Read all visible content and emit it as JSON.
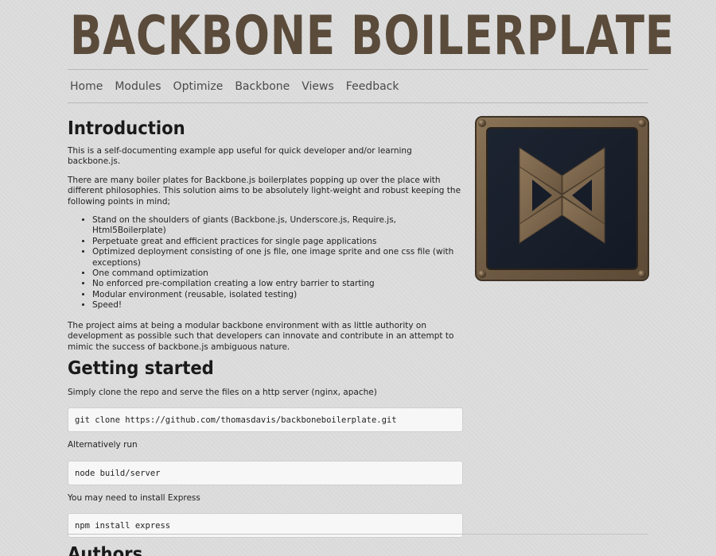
{
  "header": {
    "title": "BACKBONE BOILERPLATE"
  },
  "nav": {
    "items": [
      "Home",
      "Modules",
      "Optimize",
      "Backbone",
      "Views",
      "Feedback"
    ]
  },
  "intro": {
    "heading": "Introduction",
    "p1": "This is a self-documenting example app useful for quick developer and/or learning backbone.js.",
    "p2": "There are many boiler plates for Backbone.js boilerplates popping up over the place with different philosophies. This solution aims to be absolutely light-weight and robust keeping the following points in mind;",
    "points": [
      "Stand on the shoulders of giants (Backbone.js, Underscore.js, Require.js, Html5Boilerplate)",
      "Perpetuate great and efficient practices for single page applications",
      "Optimized deployment consisting of one js file, one image sprite and one css file (with exceptions)",
      "One command optimization",
      "No enforced pre-compilation creating a low entry barrier to starting",
      "Modular environment (reusable, isolated testing)",
      "Speed!"
    ],
    "p3": "The project aims at being a modular backbone environment with as little authority on development as possible such that developers can innovate and contribute in an attempt to mimic the success of backbone.js ambiguous nature."
  },
  "getting_started": {
    "heading": "Getting started",
    "p1": "Simply clone the repo and serve the files on a http server (nginx, apache)",
    "code1": "git clone https://github.com/thomasdavis/backboneboilerplate.git",
    "alt_label": "Alternatively run",
    "code2": "node build/server",
    "express_label": "You may need to install Express",
    "code3": "npm install express"
  },
  "authors": {
    "heading": "Authors"
  },
  "logo": {
    "icon": "backbone-logo-icon"
  }
}
